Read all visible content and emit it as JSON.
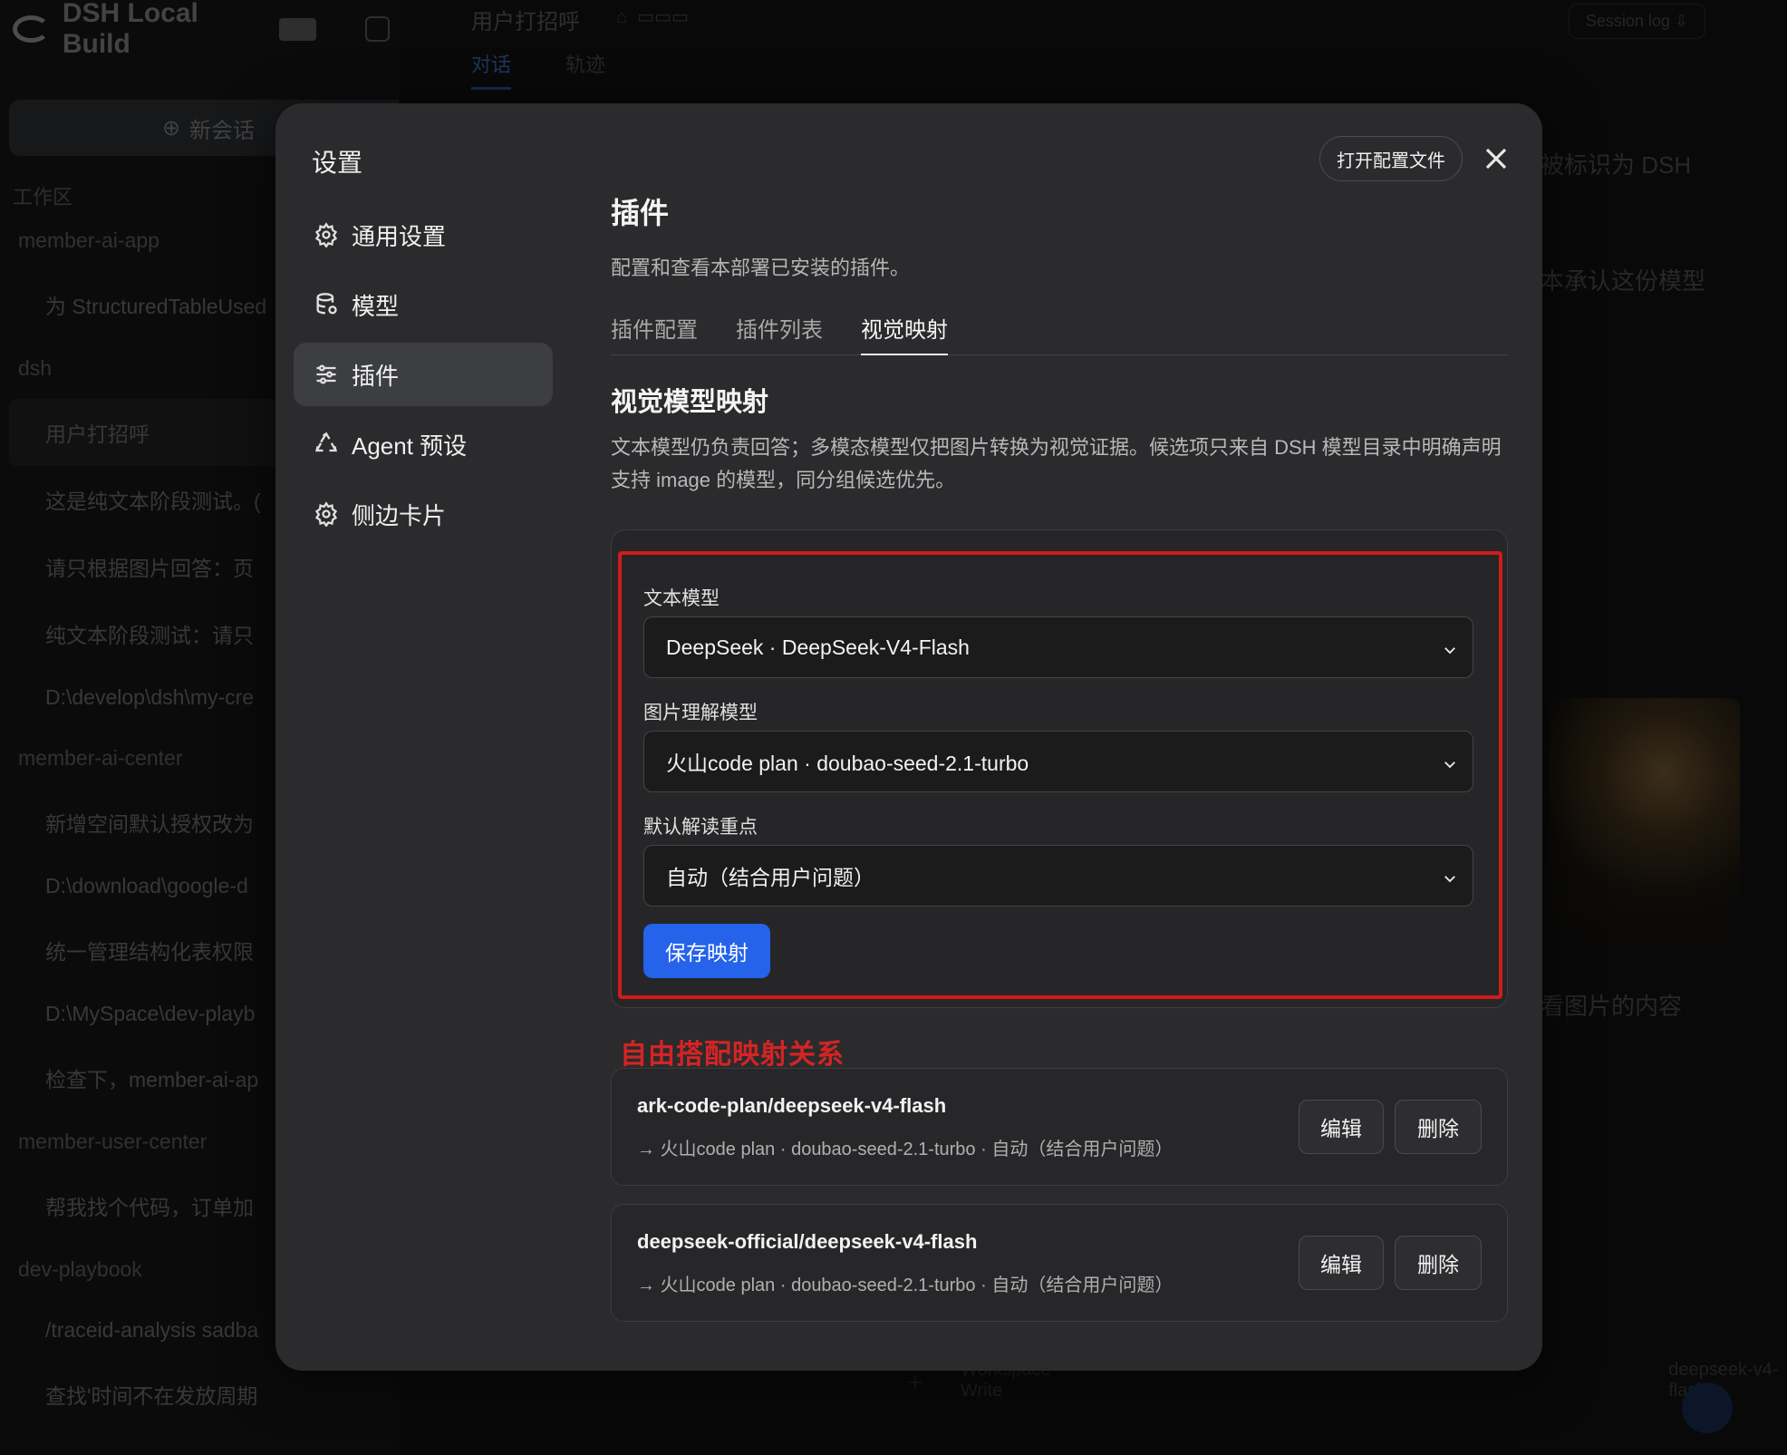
{
  "background": {
    "brand": "DSH Local Build",
    "new_chat": "新会话",
    "section": "工作区",
    "sidebar_items": [
      {
        "text": "member-ai-app",
        "kind": "folder"
      },
      {
        "text": "为 StructuredTableUsed",
        "kind": "sub"
      },
      {
        "text": "dsh",
        "kind": "folder"
      },
      {
        "text": "用户打招呼",
        "kind": "active"
      },
      {
        "text": "这是纯文本阶段测试。(",
        "kind": "sub"
      },
      {
        "text": "请只根据图片回答：页",
        "kind": "sub"
      },
      {
        "text": "纯文本阶段测试：请只",
        "kind": "sub"
      },
      {
        "text": "D:\\develop\\dsh\\my-cre",
        "kind": "sub"
      },
      {
        "text": "member-ai-center",
        "kind": "folder"
      },
      {
        "text": "新增空间默认授权改为",
        "kind": "sub"
      },
      {
        "text": "D:\\download\\google-d",
        "kind": "sub"
      },
      {
        "text": "统一管理结构化表权限",
        "kind": "sub"
      },
      {
        "text": "D:\\MySpace\\dev-playb",
        "kind": "sub"
      },
      {
        "text": "检查下，member-ai-ap",
        "kind": "sub"
      },
      {
        "text": "member-user-center",
        "kind": "folder"
      },
      {
        "text": "帮我找个代码，订单加",
        "kind": "sub"
      },
      {
        "text": "dev-playbook",
        "kind": "folder"
      },
      {
        "text": "/traceid-analysis sadba",
        "kind": "sub"
      },
      {
        "text": "查找'时间不在发放周期",
        "kind": "sub"
      }
    ],
    "top_title": "用户打招呼",
    "top_tabs": [
      "对话",
      "轨迹"
    ],
    "session_log": "Session log",
    "right_text_1": "被标识为 DSH",
    "right_text_2": "本承认这份模型",
    "right_text_3": "看图片的内容",
    "bottom_workspace": "Workspace Write",
    "bottom_model": "deepseek-v4-flash"
  },
  "modal": {
    "title": "设置",
    "open_config_label": "打开配置文件",
    "nav": [
      {
        "label": "通用设置",
        "icon": "gear-icon"
      },
      {
        "label": "模型",
        "icon": "database-icon"
      },
      {
        "label": "插件",
        "icon": "sliders-icon",
        "active": true
      },
      {
        "label": "Agent 预设",
        "icon": "recycle-icon"
      },
      {
        "label": "侧边卡片",
        "icon": "gear-icon"
      }
    ],
    "heading": "插件",
    "description": "配置和查看本部署已安装的插件。",
    "tabs": [
      {
        "label": "插件配置"
      },
      {
        "label": "插件列表"
      },
      {
        "label": "视觉映射",
        "active": true
      }
    ],
    "section_title": "视觉模型映射",
    "section_desc": "文本模型仍负责回答；多模态模型仅把图片转换为视觉证据。候选项只来自 DSH 模型目录中明确声明支持 image 的模型，同分组候选优先。",
    "form": {
      "text_model_label": "文本模型",
      "text_model_value": "DeepSeek · DeepSeek-V4-Flash",
      "image_model_label": "图片理解模型",
      "image_model_value": "火山code plan · doubao-seed-2.1-turbo",
      "focus_label": "默认解读重点",
      "focus_value": "自动（结合用户问题）",
      "save_label": "保存映射"
    },
    "annotation": "自由搭配映射关系",
    "mappings": [
      {
        "title": "ark-code-plan/deepseek-v4-flash",
        "sub": "→ 火山code plan · doubao-seed-2.1-turbo · 自动（结合用户问题）",
        "edit": "编辑",
        "delete": "删除"
      },
      {
        "title": "deepseek-official/deepseek-v4-flash",
        "sub": "→ 火山code plan · doubao-seed-2.1-turbo · 自动（结合用户问题）",
        "edit": "编辑",
        "delete": "删除"
      }
    ]
  },
  "colors": {
    "accent": "#2563eb",
    "highlight": "#d01c1c",
    "modal_bg": "#2b2b2d"
  }
}
